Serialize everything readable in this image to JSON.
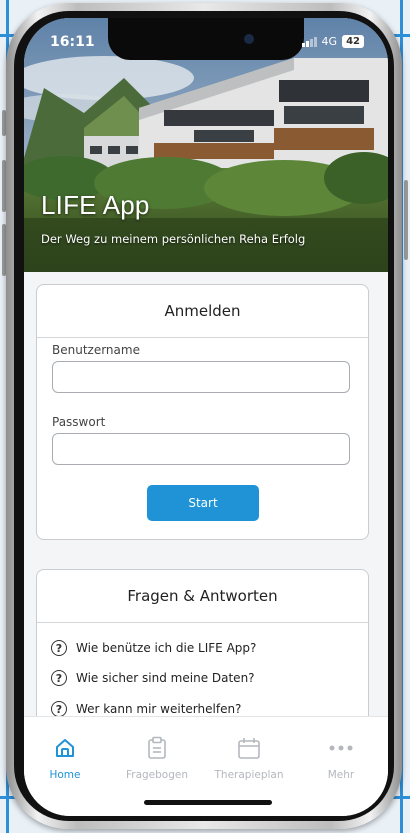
{
  "status": {
    "time": "16:11",
    "network": "4G",
    "battery": "42"
  },
  "hero": {
    "title": "LIFE App",
    "subtitle": "Der Weg zu meinem persönlichen Reha Erfolg"
  },
  "login": {
    "title": "Anmelden",
    "username_label": "Benutzername",
    "username_value": "",
    "password_label": "Passwort",
    "password_value": "",
    "start_label": "Start"
  },
  "faq": {
    "title": "Fragen & Antworten",
    "icon_glyph": "?",
    "items": [
      {
        "text": "Wie benütze ich die LIFE App?"
      },
      {
        "text": "Wie sicher sind meine Daten?"
      },
      {
        "text": "Wer kann mir weiterhelfen?"
      }
    ]
  },
  "tabs": [
    {
      "label": "Home",
      "icon": "home-icon",
      "active": true
    },
    {
      "label": "Fragebogen",
      "icon": "clipboard-icon",
      "active": false
    },
    {
      "label": "Therapieplan",
      "icon": "calendar-icon",
      "active": false
    },
    {
      "label": "Mehr",
      "icon": "more-dots-icon",
      "active": false
    }
  ],
  "colors": {
    "accent": "#1f93d6",
    "inactive": "#b4b7bc",
    "background": "#f4f5f7"
  }
}
